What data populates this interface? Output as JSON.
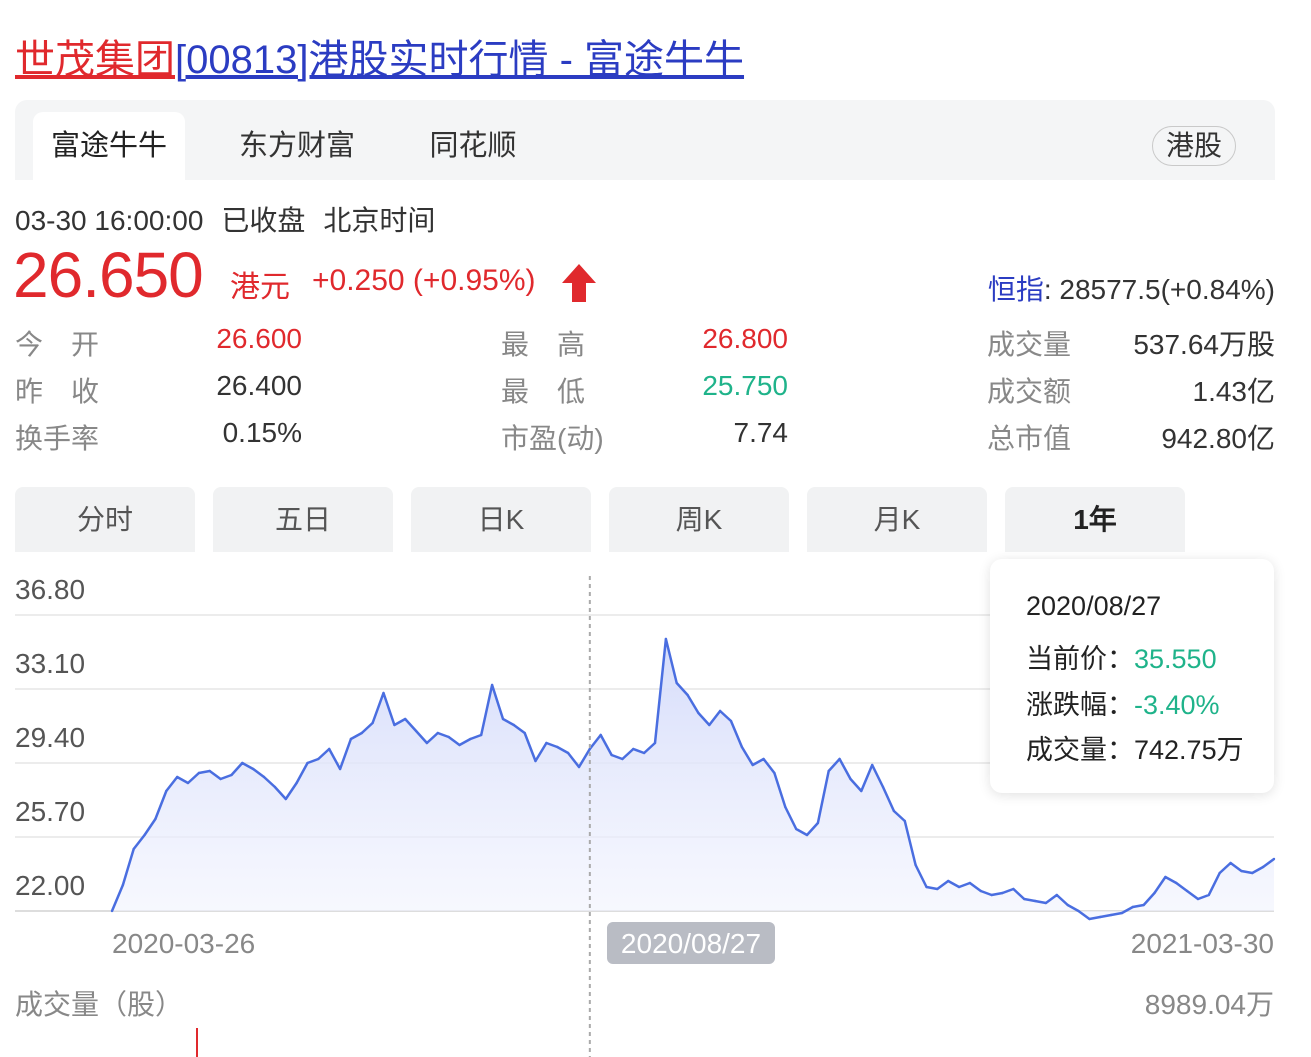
{
  "title": {
    "company": "世茂集团",
    "rest": "[00813]港股实时行情 - 富途牛牛"
  },
  "source_tabs": [
    {
      "label": "富途牛牛",
      "active": true
    },
    {
      "label": "东方财富",
      "active": false
    },
    {
      "label": "同花顺",
      "active": false
    }
  ],
  "market_badge": "港股",
  "status": {
    "datetime": "03-30 16:00:00",
    "state": "已收盘",
    "timezone": "北京时间"
  },
  "quote": {
    "price": "26.650",
    "currency": "港元",
    "change": "+0.250 (+0.95%)",
    "direction": "up",
    "up_color": "#e0292d",
    "down_color": "#1fb38a"
  },
  "index": {
    "name": "恒指",
    "value": ": 28577.5(+0.84%)"
  },
  "stats": [
    {
      "label": "今　开",
      "value": "26.600",
      "color": "red"
    },
    {
      "label": "最　高",
      "value": "26.800",
      "color": "red"
    },
    {
      "label": "成交量",
      "value": "537.64万股",
      "color": "dark"
    },
    {
      "label": "昨　收",
      "value": "26.400",
      "color": "dark"
    },
    {
      "label": "最　低",
      "value": "25.750",
      "color": "green"
    },
    {
      "label": "成交额",
      "value": "1.43亿",
      "color": "dark"
    },
    {
      "label": "换手率",
      "value": "0.15%",
      "color": "dark"
    },
    {
      "label": "市盈(动)",
      "value": "7.74",
      "color": "dark"
    },
    {
      "label": "总市值",
      "value": "942.80亿",
      "color": "dark"
    }
  ],
  "period_tabs": [
    {
      "label": "分时",
      "active": false
    },
    {
      "label": "五日",
      "active": false
    },
    {
      "label": "日K",
      "active": false
    },
    {
      "label": "周K",
      "active": false
    },
    {
      "label": "月K",
      "active": false
    },
    {
      "label": "1年",
      "active": true
    }
  ],
  "tooltip": {
    "date": "2020/08/27",
    "price_label": "当前价：",
    "price_value": "35.550",
    "change_label": "涨跌幅：",
    "change_value": "-3.40%",
    "volume_label": "成交量：",
    "volume_value": "742.75万"
  },
  "volume": {
    "label": "成交量（股）",
    "max": "8989.04万"
  },
  "chart_data": {
    "type": "area",
    "line_color": "#4a6ee0",
    "fill_color": "#dfe4fb",
    "yticks": [
      "36.80",
      "33.10",
      "29.40",
      "25.70",
      "22.00"
    ],
    "ylim": [
      22.0,
      36.8
    ],
    "x_start_label": "2020-03-26",
    "x_end_label": "2021-03-30",
    "crosshair_label": "2020/08/27",
    "crosshair_index": 102,
    "x_dates": [
      "2020-03-26",
      "2020-03-29",
      "2020-04-01",
      "2020-04-04",
      "2020-04-07",
      "2020-04-10",
      "2020-04-13",
      "2020-04-16",
      "2020-04-19",
      "2020-04-22",
      "2020-04-25",
      "2020-04-28",
      "2020-05-01",
      "2020-05-04",
      "2020-05-07",
      "2020-05-10",
      "2020-05-13",
      "2020-05-16",
      "2020-05-19",
      "2020-05-22",
      "2020-05-25",
      "2020-05-28",
      "2020-05-31",
      "2020-06-03",
      "2020-06-06",
      "2020-06-09",
      "2020-06-12",
      "2020-06-15",
      "2020-06-18",
      "2020-06-21",
      "2020-06-24",
      "2020-06-27",
      "2020-06-30",
      "2020-07-03",
      "2020-07-06",
      "2020-07-09",
      "2020-07-12",
      "2020-07-15",
      "2020-07-18",
      "2020-07-21",
      "2020-07-24",
      "2020-07-27",
      "2020-07-30",
      "2020-08-02",
      "2020-08-05",
      "2020-08-08",
      "2020-08-11",
      "2020-08-14",
      "2020-08-17",
      "2020-08-20",
      "2020-08-23",
      "2020-08-27",
      "2020-08-30",
      "2020-09-02",
      "2020-09-05",
      "2020-09-08",
      "2020-09-11",
      "2020-09-14",
      "2020-09-17",
      "2020-09-20",
      "2020-09-23",
      "2020-09-26",
      "2020-09-29",
      "2020-10-02",
      "2020-10-05",
      "2020-10-08",
      "2020-10-11",
      "2020-10-14",
      "2020-10-17",
      "2020-10-20",
      "2020-10-23",
      "2020-10-26",
      "2020-10-29",
      "2020-11-01",
      "2020-11-04",
      "2020-11-07",
      "2020-11-10",
      "2020-11-13",
      "2020-11-16",
      "2020-11-19",
      "2020-11-22",
      "2020-11-25",
      "2020-11-28",
      "2020-12-01",
      "2020-12-04",
      "2020-12-07",
      "2020-12-10",
      "2020-12-13",
      "2020-12-16",
      "2020-12-19",
      "2020-12-22",
      "2020-12-25",
      "2020-12-28",
      "2020-12-31",
      "2021-01-03",
      "2021-01-06",
      "2021-01-09",
      "2021-01-12",
      "2021-01-15",
      "2021-01-18",
      "2021-01-21",
      "2021-01-24",
      "2021-01-27",
      "2021-01-30",
      "2021-02-02",
      "2021-02-05",
      "2021-02-08",
      "2021-02-11",
      "2021-02-14",
      "2021-02-17",
      "2021-02-20",
      "2021-02-23",
      "2021-02-26",
      "2021-03-01",
      "2021-03-04",
      "2021-03-07",
      "2021-03-10",
      "2021-03-13",
      "2021-03-16",
      "2021-03-19",
      "2021-03-22",
      "2021-03-25",
      "2021-03-30"
    ],
    "close": [
      22.0,
      23.3,
      25.1,
      25.8,
      26.6,
      28.0,
      28.7,
      28.4,
      28.9,
      29.0,
      28.6,
      28.8,
      29.4,
      29.1,
      28.7,
      28.2,
      27.6,
      28.4,
      29.4,
      29.6,
      30.1,
      29.1,
      30.6,
      30.9,
      31.4,
      32.9,
      31.3,
      31.6,
      31.0,
      30.4,
      30.9,
      30.7,
      30.3,
      30.6,
      30.8,
      33.3,
      31.6,
      31.3,
      30.9,
      29.5,
      30.4,
      30.2,
      29.9,
      29.2,
      30.1,
      30.8,
      29.8,
      29.6,
      30.1,
      29.9,
      30.4,
      35.6,
      33.4,
      32.8,
      31.9,
      31.3,
      32.0,
      31.5,
      30.2,
      29.3,
      29.6,
      28.9,
      27.2,
      26.1,
      25.8,
      26.4,
      29.0,
      29.6,
      28.6,
      28.0,
      29.3,
      28.2,
      27.0,
      26.5,
      24.3,
      23.2,
      23.1,
      23.5,
      23.2,
      23.4,
      23.0,
      22.8,
      22.9,
      23.1,
      22.6,
      22.5,
      22.4,
      22.8,
      22.3,
      22.0,
      21.6,
      21.7,
      21.8,
      21.9,
      22.2,
      22.3,
      22.9,
      23.7,
      23.4,
      23.0,
      22.6,
      22.8,
      23.9,
      24.4,
      24.0,
      23.9,
      24.2,
      24.6
    ]
  }
}
